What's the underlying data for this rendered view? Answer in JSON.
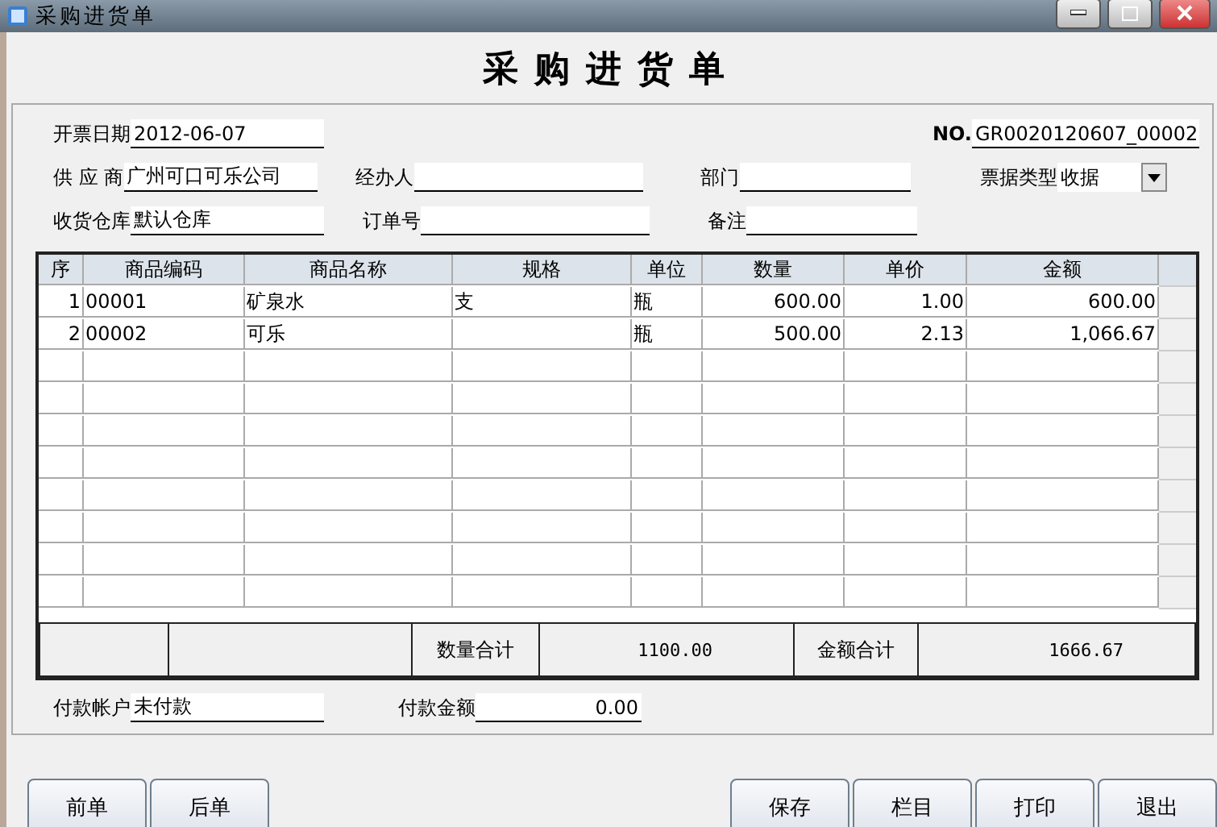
{
  "window": {
    "title": "采购进货单"
  },
  "heading": "采购进货单",
  "fields_row1": {
    "date": {
      "label": "开票日期",
      "value": "2012-06-07"
    },
    "no": {
      "label": "NO.",
      "value": "GR0020120607_00002"
    }
  },
  "fields_row2": [
    {
      "label": "供 应 商",
      "value": "广州可口可乐公司"
    },
    {
      "label": "经办人"
    },
    {
      "label": "部门"
    }
  ],
  "bill_type": {
    "label": "票据类型",
    "value": "收据"
  },
  "fields_row3": [
    {
      "label": "收货仓库",
      "value": "默认仓库"
    },
    {
      "label": "订单号"
    },
    {
      "label": "备注"
    }
  ],
  "table": {
    "columns": [
      "序",
      "商品编码",
      "商品名称",
      "规格",
      "单位",
      "数量",
      "单价",
      "金额"
    ],
    "rows": [
      [
        "1",
        "00001",
        "矿泉水",
        "支",
        "瓶",
        "600.00",
        "1.00",
        "600.00"
      ],
      [
        "2",
        "00002",
        "可乐",
        "",
        "瓶",
        "500.00",
        "2.13",
        "1,066.67"
      ]
    ]
  },
  "totals": {
    "qty_label": "数量合计",
    "qty": "1100.00",
    "amount_label": "金额合计",
    "amount": "1666.67"
  },
  "payment": {
    "account_label": "付款帐户",
    "account": "未付款",
    "amount_label": "付款金额",
    "amount": "0.00"
  },
  "buttons_left": [
    "前单",
    "后单"
  ],
  "buttons_right": [
    "保存",
    "栏目",
    "打印",
    "退出"
  ]
}
